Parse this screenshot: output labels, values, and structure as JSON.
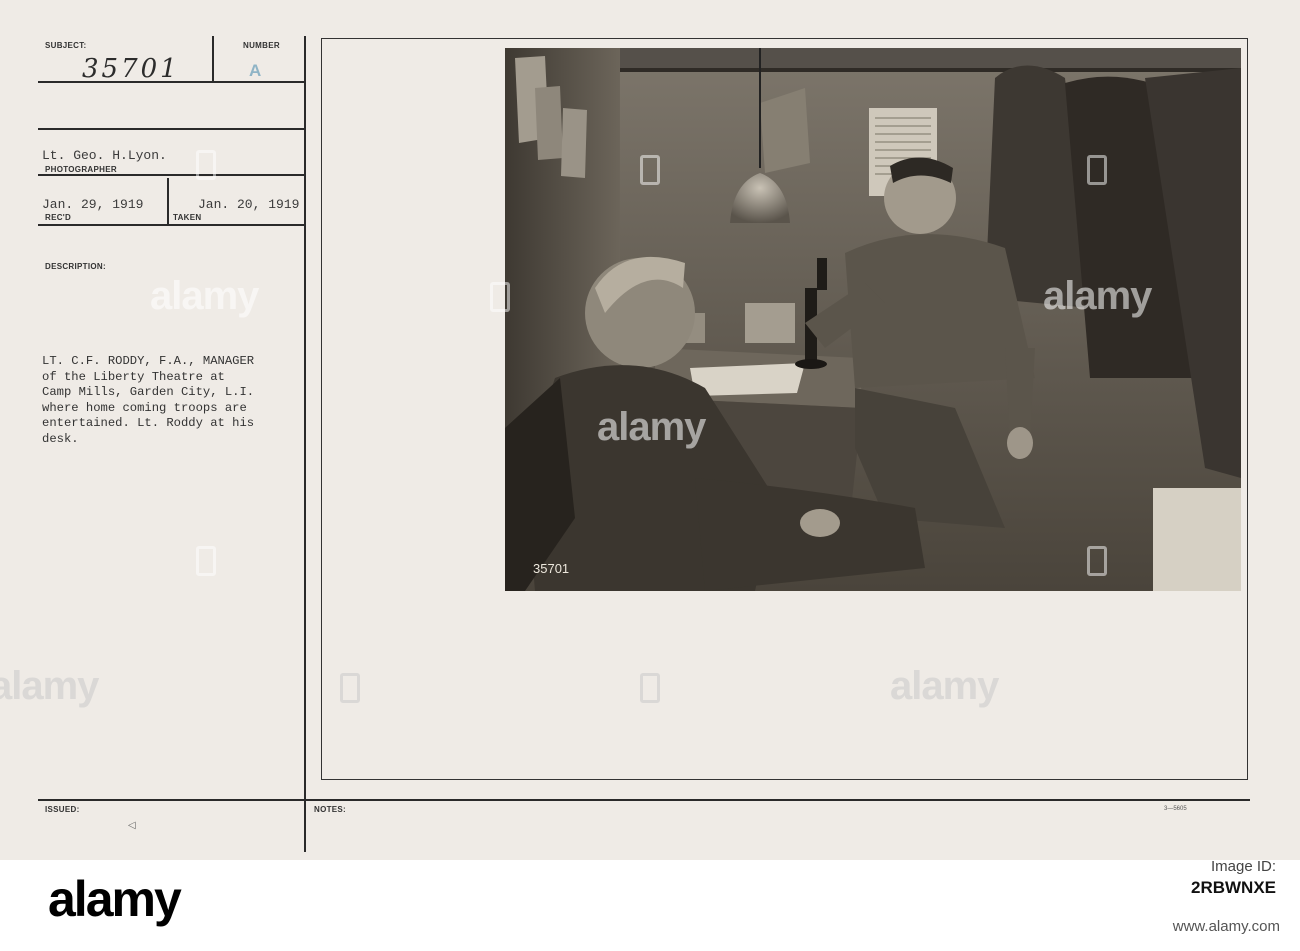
{
  "card": {
    "subject_label": "SUBJECT:",
    "number_label": "NUMBER",
    "subject_value": "35701",
    "number_value": "A",
    "photographer_value": "Lt. Geo. H.Lyon.",
    "photographer_label": "PHOTOGRAPHER",
    "recd_value": "Jan. 29, 1919",
    "recd_label": "REC'D",
    "taken_value": "Jan. 20, 1919",
    "taken_label": "TAKEN",
    "description_label": "DESCRIPTION:",
    "description_lines": [
      "LT. C.F. RODDY, F.A., MANAGER",
      "of the Liberty Theatre at",
      "Camp Mills, Garden City, L.I.",
      "where home coming troops are",
      "entertained. Lt. Roddy at his",
      "desk."
    ],
    "issued_label": "ISSUED:",
    "notes_label": "NOTES:",
    "form_number": "3—5605",
    "photo_negative_number": "35701"
  },
  "watermark": {
    "text": "alamy"
  },
  "footer": {
    "logo_text": "alamy",
    "image_id_label": "Image ID:",
    "image_id": "2RBWNXE",
    "url": "www.alamy.com"
  },
  "colors": {
    "card_background": "#efebe6",
    "photo_sepia_dark": "#2c2822",
    "photo_sepia_light": "#bdb5a8"
  }
}
